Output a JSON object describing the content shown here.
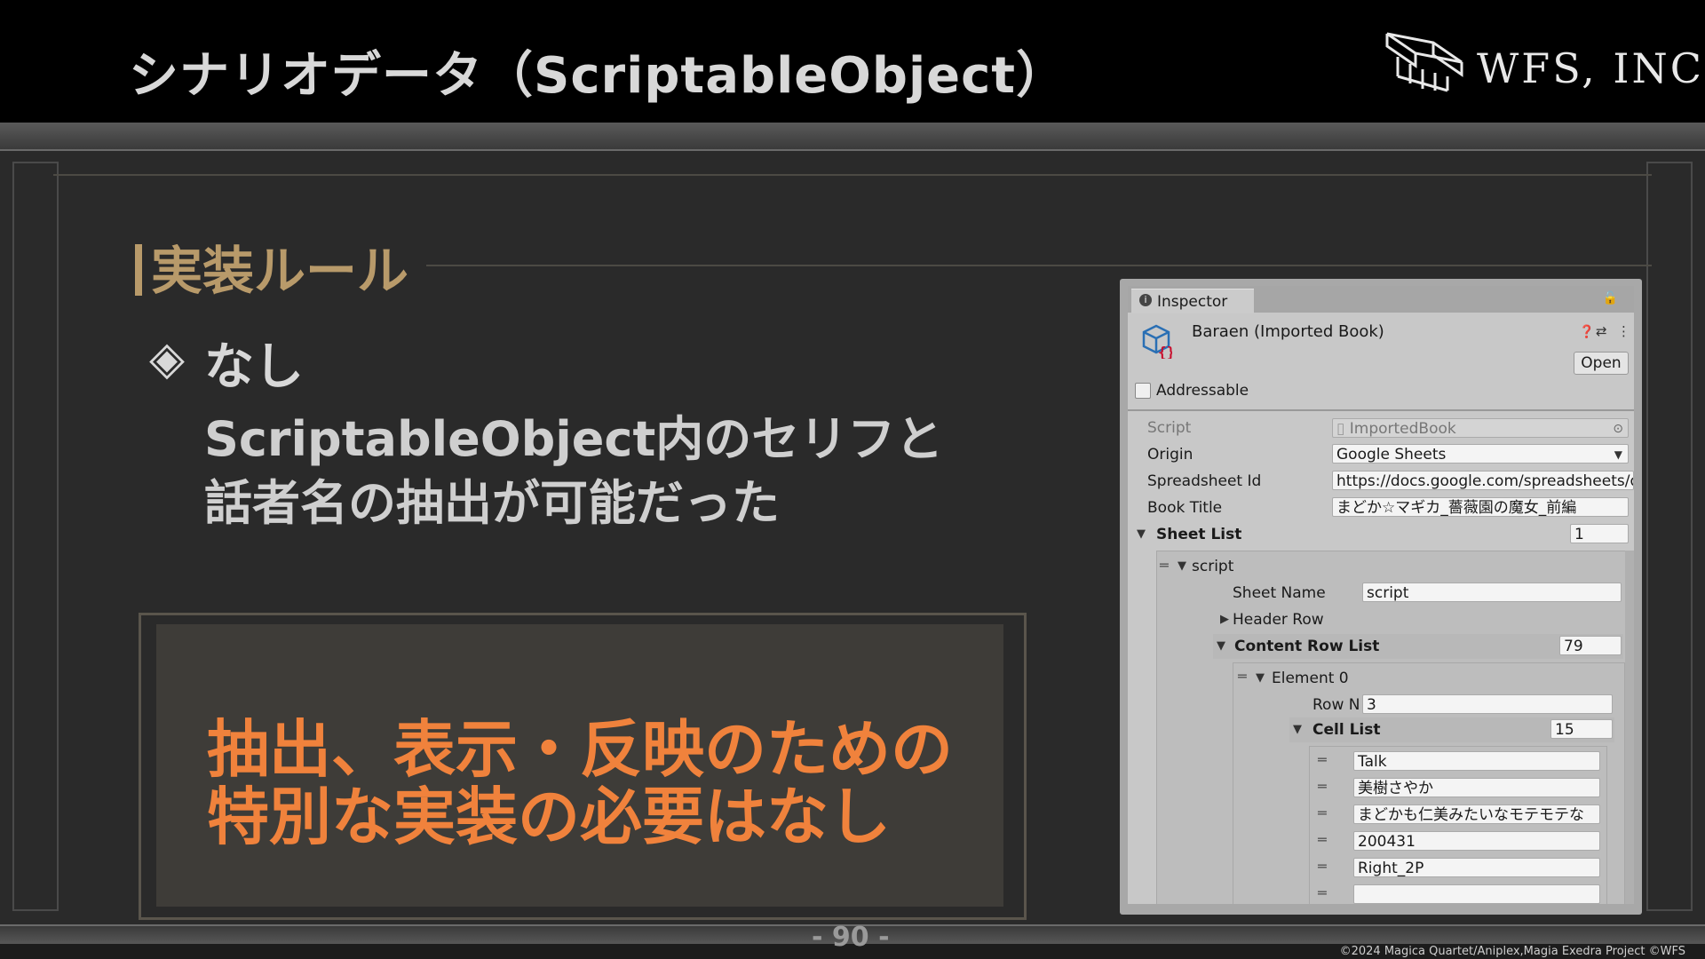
{
  "slide": {
    "title": "シナリオデータ（ScriptableObject）",
    "company": "WFS, INC.",
    "heading": "実装ルール",
    "bullet_icon": "diamond-bullet-icon",
    "bullet_glyph": "◈",
    "bullet_label": "なし",
    "body_lines": [
      "ScriptableObject内のセリフと",
      "話者名の抽出が可能だった"
    ],
    "emphasis_lines": [
      "抽出、表示・反映のための",
      "特別な実装の必要はなし"
    ],
    "page_number": "- 90 -",
    "copyright": "©2024 Magica Quartet/Aniplex,Magia Exedra Project ©WFS"
  },
  "inspector": {
    "tab_label": "Inspector",
    "object_title": "Baraen (Imported Book)",
    "open_label": "Open",
    "addressable_label": "Addressable",
    "addressable_checked": false,
    "fields": {
      "script_label": "Script",
      "script_value": "ImportedBook",
      "origin_label": "Origin",
      "origin_value": "Google Sheets",
      "spreadsheet_label": "Spreadsheet Id",
      "spreadsheet_value": "https://docs.google.com/spreadsheets/d",
      "book_title_label": "Book Title",
      "book_title_value": "まどか☆マギカ_薔薇園の魔女_前編"
    },
    "sheet_list": {
      "label": "Sheet List",
      "count": "1",
      "item_label": "script",
      "sheet_name_label": "Sheet Name",
      "sheet_name_value": "script",
      "header_row_label": "Header Row",
      "content_row_list_label": "Content Row List",
      "content_row_count": "79",
      "element_label": "Element 0",
      "row_n_label": "Row N",
      "row_n_value": "3",
      "cell_list_label": "Cell List",
      "cell_count": "15",
      "cells": [
        "Talk",
        "美樹さやか",
        "まどかも仁美みたいなモテモテな",
        "200431",
        "Right_2P",
        ""
      ]
    }
  }
}
